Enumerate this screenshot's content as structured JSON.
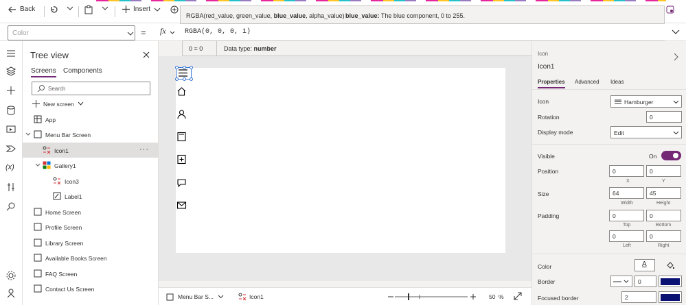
{
  "toolbar": {
    "back_label": "Back",
    "insert_label": "Insert"
  },
  "formula": {
    "property": "Color",
    "eq": "=",
    "fx": "fx",
    "text": "RGBA(0, 0, 0, 1)",
    "signature": "RGBA(red_value, green_value, blue_value, alpha_value)",
    "signature_pre": "RGBA(red_value, green_value, ",
    "signature_bold": "blue_value",
    "signature_post": ", alpha_value)",
    "param_name": "blue_value:",
    "param_desc": " The blue component, 0 to 255.",
    "result": "0  =  0",
    "data_type_label": "Data type: ",
    "data_type_value": "number"
  },
  "tree": {
    "title": "Tree view",
    "tabs": [
      "Screens",
      "Components"
    ],
    "search_placeholder": "Search",
    "new_screen": "New screen",
    "items": [
      {
        "label": "App"
      },
      {
        "label": "Menu Bar Screen"
      },
      {
        "label": "Icon1"
      },
      {
        "label": "Gallery1"
      },
      {
        "label": "Icon3"
      },
      {
        "label": "Label1"
      },
      {
        "label": "Home Screen"
      },
      {
        "label": "Profile Screen"
      },
      {
        "label": "Library Screen"
      },
      {
        "label": "Available Books Screen"
      },
      {
        "label": "FAQ Screen"
      },
      {
        "label": "Contact Us Screen"
      }
    ]
  },
  "status": {
    "screen": "Menu Bar S...",
    "control": "Icon1",
    "zoom": "50",
    "zoom_unit": "%"
  },
  "props": {
    "partial_header": "Icon",
    "name": "Icon1",
    "tabs": [
      "Properties",
      "Advanced",
      "Ideas"
    ],
    "icon_label": "Icon",
    "icon_value": "Hamburger",
    "rotation_label": "Rotation",
    "rotation_value": "0",
    "display_mode_label": "Display mode",
    "display_mode_value": "Edit",
    "visible_label": "Visible",
    "visible_state": "On",
    "position_label": "Position",
    "pos_x": "0",
    "pos_y": "0",
    "x_label": "X",
    "y_label": "Y",
    "size_label": "Size",
    "width_value": "64",
    "height_value": "45",
    "width_label": "Width",
    "height_label": "Height",
    "padding_label": "Padding",
    "pad_top": "0",
    "pad_bottom": "0",
    "pad_left": "0",
    "pad_right": "0",
    "top_label": "Top",
    "bottom_label": "Bottom",
    "left_label": "Left",
    "right_label": "Right",
    "color_label": "Color",
    "border_label": "Border",
    "border_value": "0",
    "focused_border_label": "Focused border",
    "focused_border_value": "2",
    "swatch_color": "#0a1172",
    "toggle_color": "#742774"
  }
}
